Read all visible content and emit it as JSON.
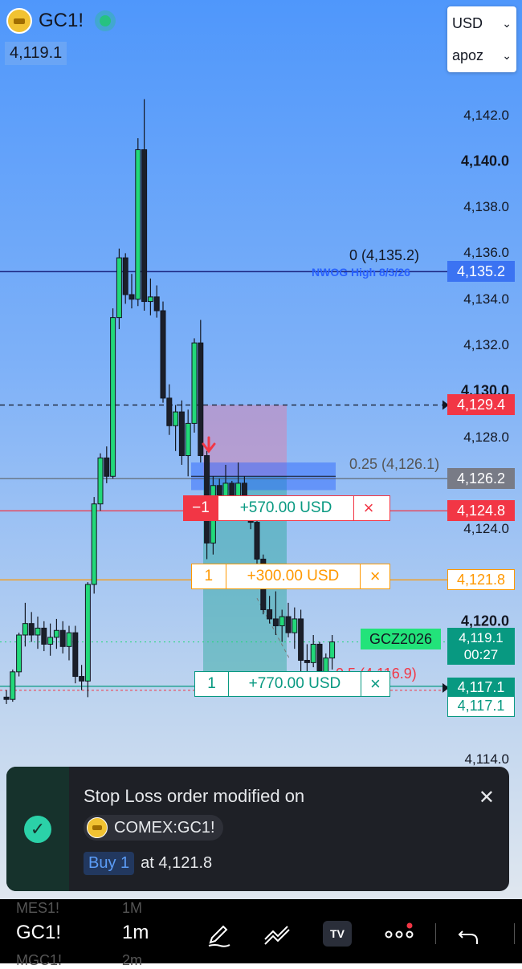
{
  "symbol": {
    "name": "GC1!",
    "last_price": "4,119.1",
    "icon": "gold-bar-icon"
  },
  "selectors": {
    "currency": "USD",
    "account": "apoz"
  },
  "axis_labels": [
    {
      "text": "4,142.0",
      "price": 4142.0,
      "bold": false
    },
    {
      "text": "4,140.0",
      "price": 4140.0,
      "bold": true
    },
    {
      "text": "4,138.0",
      "price": 4138.0,
      "bold": false
    },
    {
      "text": "4,136.0",
      "price": 4136.0,
      "bold": false
    },
    {
      "text": "4,134.0",
      "price": 4134.0,
      "bold": false
    },
    {
      "text": "4,132.0",
      "price": 4132.0,
      "bold": false
    },
    {
      "text": "4,130.0",
      "price": 4130.0,
      "bold": true
    },
    {
      "text": "4,128.0",
      "price": 4128.0,
      "bold": false
    },
    {
      "text": "4,124.0",
      "price": 4124.0,
      "bold": false
    },
    {
      "text": "4,120.0",
      "price": 4120.0,
      "bold": true
    },
    {
      "text": "4,114.0",
      "price": 4114.0,
      "bold": false
    }
  ],
  "price_badges": [
    {
      "text": "4,135.2",
      "price": 4135.2,
      "style": "blue"
    },
    {
      "text": "4,129.4",
      "price": 4129.4,
      "style": "red"
    },
    {
      "text": "4,126.2",
      "price": 4126.2,
      "style": "gray"
    },
    {
      "text": "4,124.8",
      "price": 4124.8,
      "style": "red"
    },
    {
      "text": "4,121.8",
      "price": 4121.8,
      "style": "orange"
    },
    {
      "text": "4,117.1",
      "price": 4117.1,
      "style": "teal"
    },
    {
      "text": "4,117.1",
      "price": 4116.3,
      "style": "tealout"
    }
  ],
  "current_price": {
    "price": "4,119.1",
    "countdown": "00:27",
    "contract": "GCZ2026"
  },
  "fib": {
    "level_0": "0 (4,135.2)",
    "level_025": "0.25 (4,126.1)",
    "level_05": "0.5 (4,116.9)"
  },
  "annotation": "NWOG High 8/3/26",
  "orders": [
    {
      "qty": "−1",
      "pnl": "+570.00 USD",
      "price": 4124.8,
      "style": "red"
    },
    {
      "qty": "1",
      "pnl": "+300.00 USD",
      "price": 4121.8,
      "style": "orange"
    },
    {
      "qty": "1",
      "pnl": "+770.00 USD",
      "price": 4117.1,
      "style": "teal"
    }
  ],
  "toast": {
    "title": "Stop Loss order modified on",
    "exchange_symbol": "COMEX:GC1!",
    "side": "Buy 1",
    "detail": "at 4,121.8"
  },
  "toolbar": {
    "symbol": "GC1!",
    "interval": "1m",
    "ghost_symbols": [
      "MES1!",
      "MGC1!"
    ],
    "ghost_intervals": [
      "1M",
      "2m"
    ]
  },
  "colors": {
    "up": "#22d879",
    "down": "#1b1f2a",
    "stop": "#f23645",
    "limit": "#ff9800",
    "target": "#089981",
    "accent": "#2962ff"
  },
  "chart_data": {
    "type": "candlestick",
    "ylim": [
      4112.8,
      4145.0
    ],
    "candles": [
      [
        4116.7,
        4117.0,
        4116.4,
        4116.6
      ],
      [
        4116.6,
        4117.9,
        4116.5,
        4117.8
      ],
      [
        4117.8,
        4119.5,
        4117.6,
        4119.4
      ],
      [
        4119.4,
        4120.8,
        4118.9,
        4119.9
      ],
      [
        4119.9,
        4120.4,
        4119.1,
        4119.4
      ],
      [
        4119.4,
        4120.2,
        4118.8,
        4119.7
      ],
      [
        4119.7,
        4120.0,
        4118.7,
        4119.0
      ],
      [
        4119.0,
        4119.9,
        4118.5,
        4119.3
      ],
      [
        4119.3,
        4120.1,
        4118.8,
        4119.6
      ],
      [
        4119.6,
        4120.0,
        4118.6,
        4118.9
      ],
      [
        4118.9,
        4119.8,
        4118.3,
        4119.5
      ],
      [
        4119.5,
        4119.8,
        4117.3,
        4117.6
      ],
      [
        4117.6,
        4118.1,
        4117.0,
        4117.4
      ],
      [
        4117.4,
        4121.7,
        4116.7,
        4121.6
      ],
      [
        4121.6,
        4125.4,
        4121.2,
        4125.1
      ],
      [
        4125.1,
        4127.3,
        4124.8,
        4127.1
      ],
      [
        4127.1,
        4127.6,
        4126.0,
        4126.3
      ],
      [
        4126.3,
        4133.6,
        4126.2,
        4133.2
      ],
      [
        4133.2,
        4136.2,
        4132.7,
        4135.8
      ],
      [
        4135.8,
        4136.0,
        4133.8,
        4134.2
      ],
      [
        4134.2,
        4135.1,
        4133.6,
        4134.0
      ],
      [
        4134.0,
        4141.0,
        4133.7,
        4140.5
      ],
      [
        4140.5,
        4142.7,
        4133.5,
        4133.9
      ],
      [
        4133.9,
        4134.9,
        4133.3,
        4134.1
      ],
      [
        4134.1,
        4134.6,
        4133.2,
        4133.5
      ],
      [
        4133.5,
        4133.9,
        4129.5,
        4129.7
      ],
      [
        4129.7,
        4130.3,
        4128.1,
        4128.5
      ],
      [
        4128.5,
        4129.4,
        4127.4,
        4129.1
      ],
      [
        4129.1,
        4129.6,
        4126.8,
        4127.2
      ],
      [
        4127.2,
        4129.2,
        4126.3,
        4128.6
      ],
      [
        4128.6,
        4132.3,
        4128.2,
        4132.1
      ],
      [
        4132.1,
        4133.1,
        4126.9,
        4127.2
      ],
      [
        4127.2,
        4127.4,
        4122.7,
        4123.4
      ],
      [
        4123.4,
        4126.3,
        4122.9,
        4125.9
      ],
      [
        4125.9,
        4126.2,
        4125.1,
        4125.3
      ],
      [
        4125.3,
        4126.8,
        4125.1,
        4126.0
      ],
      [
        4126.0,
        4126.1,
        4124.8,
        4125.1
      ],
      [
        4125.1,
        4126.9,
        4124.9,
        4126.0
      ],
      [
        4126.0,
        4126.3,
        4124.5,
        4124.7
      ],
      [
        4124.7,
        4125.1,
        4124.0,
        4124.3
      ],
      [
        4124.3,
        4124.8,
        4122.4,
        4122.7
      ],
      [
        4122.7,
        4122.9,
        4120.3,
        4120.5
      ],
      [
        4120.5,
        4121.1,
        4119.9,
        4120.1
      ],
      [
        4120.1,
        4121.3,
        4119.4,
        4119.8
      ],
      [
        4119.8,
        4120.5,
        4119.1,
        4120.2
      ],
      [
        4120.2,
        4120.8,
        4119.3,
        4119.5
      ],
      [
        4119.5,
        4120.6,
        4118.8,
        4120.1
      ],
      [
        4120.1,
        4120.5,
        4117.8,
        4118.3
      ],
      [
        4118.3,
        4119.0,
        4117.5,
        4118.2
      ],
      [
        4118.2,
        4119.4,
        4118.0,
        4119.0
      ],
      [
        4119.0,
        4119.1,
        4117.4,
        4117.6
      ],
      [
        4117.6,
        4118.6,
        4117.4,
        4118.4
      ],
      [
        4118.4,
        4119.4,
        4117.9,
        4119.1
      ]
    ]
  }
}
